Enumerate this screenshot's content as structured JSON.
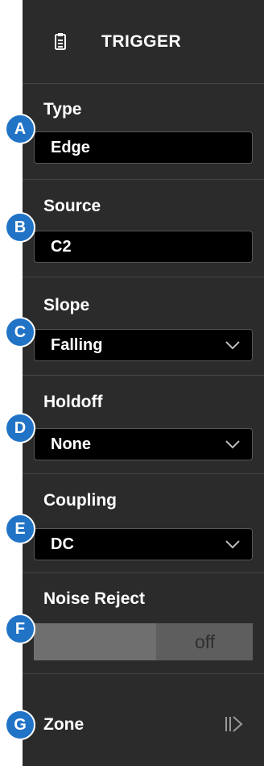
{
  "header": {
    "title": "TRIGGER",
    "icon": "clipboard-icon"
  },
  "sections": {
    "type": {
      "label": "Type",
      "value": "Edge"
    },
    "source": {
      "label": "Source",
      "value": "C2"
    },
    "slope": {
      "label": "Slope",
      "value": "Falling"
    },
    "holdoff": {
      "label": "Holdoff",
      "value": "None"
    },
    "coupling": {
      "label": "Coupling",
      "value": "DC"
    },
    "noise": {
      "label": "Noise Reject",
      "state": "off"
    },
    "zone": {
      "label": "Zone"
    }
  },
  "markers": [
    "A",
    "B",
    "C",
    "D",
    "E",
    "F",
    "G"
  ],
  "colors": {
    "panel": "#2b2b2b",
    "field": "#000000",
    "marker": "#2173c6",
    "toggle": "#5e5e5e"
  }
}
